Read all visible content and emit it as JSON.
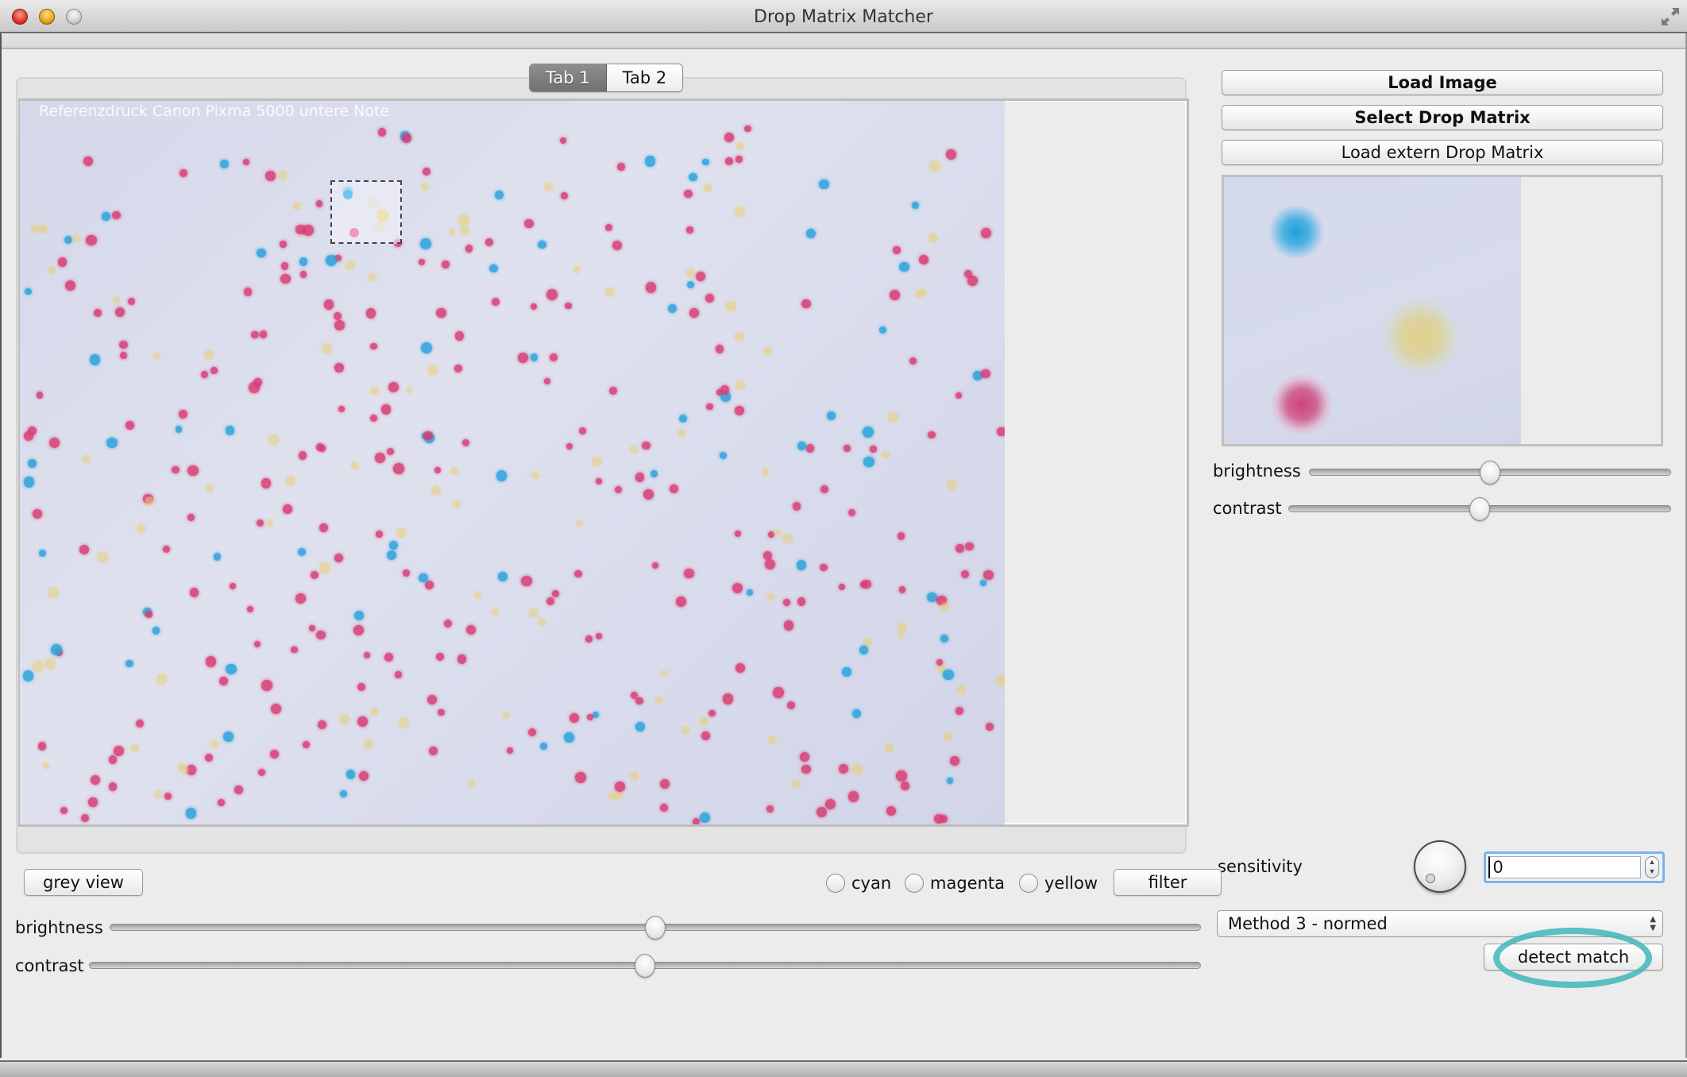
{
  "window": {
    "title": "Drop Matrix Matcher",
    "controls": [
      "close",
      "minimize",
      "zoom",
      "fullscreen"
    ]
  },
  "tabs": [
    {
      "label": "Tab 1",
      "active": true
    },
    {
      "label": "Tab 2",
      "active": false
    }
  ],
  "main_image": {
    "caption": "Referenzdruck Canon Pixma 5000 untere Note",
    "has_selection_box": true
  },
  "right_panel": {
    "buttons": {
      "load_image": "Load Image",
      "select_drop_matrix": "Select Drop Matrix",
      "load_extern_drop_matrix": "Load extern Drop Matrix"
    },
    "preview": {
      "description": "Selected drop matrix preview (cyan, yellow, magenta drops)"
    },
    "brightness": {
      "label": "brightness",
      "value_fraction": 0.5
    },
    "contrast": {
      "label": "contrast",
      "value_fraction": 0.5
    },
    "sensitivity": {
      "label": "sensitivity",
      "value": "0"
    },
    "method": {
      "selected": "Method 3 - normed"
    },
    "detect_match_label": "detect match"
  },
  "bottom_panel": {
    "grey_view_label": "grey view",
    "radios": [
      {
        "label": "cyan",
        "checked": false
      },
      {
        "label": "magenta",
        "checked": false
      },
      {
        "label": "yellow",
        "checked": false
      }
    ],
    "filter_label": "filter",
    "brightness": {
      "label": "brightness",
      "value_fraction": 0.5
    },
    "contrast": {
      "label": "contrast",
      "value_fraction": 0.5
    }
  },
  "colors": {
    "cyan": "#2aa2dc",
    "magenta": "#d83c73",
    "yellow": "#e8cf78",
    "highlight": "#4bb9bb"
  }
}
